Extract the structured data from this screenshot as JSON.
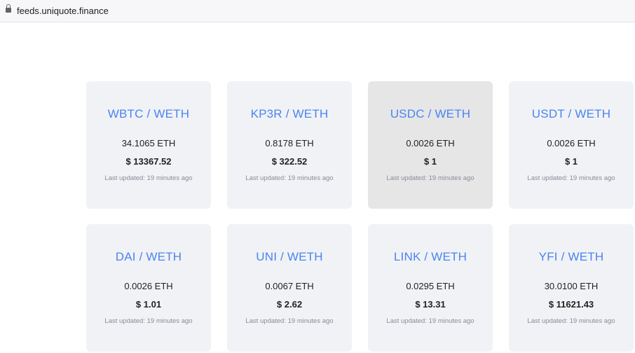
{
  "browser": {
    "url": "feeds.uniquote.finance"
  },
  "cards": [
    {
      "pair": "WBTC / WETH",
      "eth": "34.1065 ETH",
      "usd": "$ 13367.52",
      "updated": "Last updated: 19 minutes ago"
    },
    {
      "pair": "KP3R / WETH",
      "eth": "0.8178 ETH",
      "usd": "$ 322.52",
      "updated": "Last updated: 19 minutes ago"
    },
    {
      "pair": "USDC / WETH",
      "eth": "0.0026 ETH",
      "usd": "$ 1",
      "updated": "Last updated: 19 minutes ago"
    },
    {
      "pair": "USDT / WETH",
      "eth": "0.0026 ETH",
      "usd": "$ 1",
      "updated": "Last updated: 19 minutes ago"
    },
    {
      "pair": "DAI / WETH",
      "eth": "0.0026 ETH",
      "usd": "$ 1.01",
      "updated": "Last updated: 19 minutes ago"
    },
    {
      "pair": "UNI / WETH",
      "eth": "0.0067 ETH",
      "usd": "$ 2.62",
      "updated": "Last updated: 19 minutes ago"
    },
    {
      "pair": "LINK / WETH",
      "eth": "0.0295 ETH",
      "usd": "$ 13.31",
      "updated": "Last updated: 19 minutes ago"
    },
    {
      "pair": "YFI / WETH",
      "eth": "30.0100 ETH",
      "usd": "$ 11621.43",
      "updated": "Last updated: 19 minutes ago"
    }
  ]
}
